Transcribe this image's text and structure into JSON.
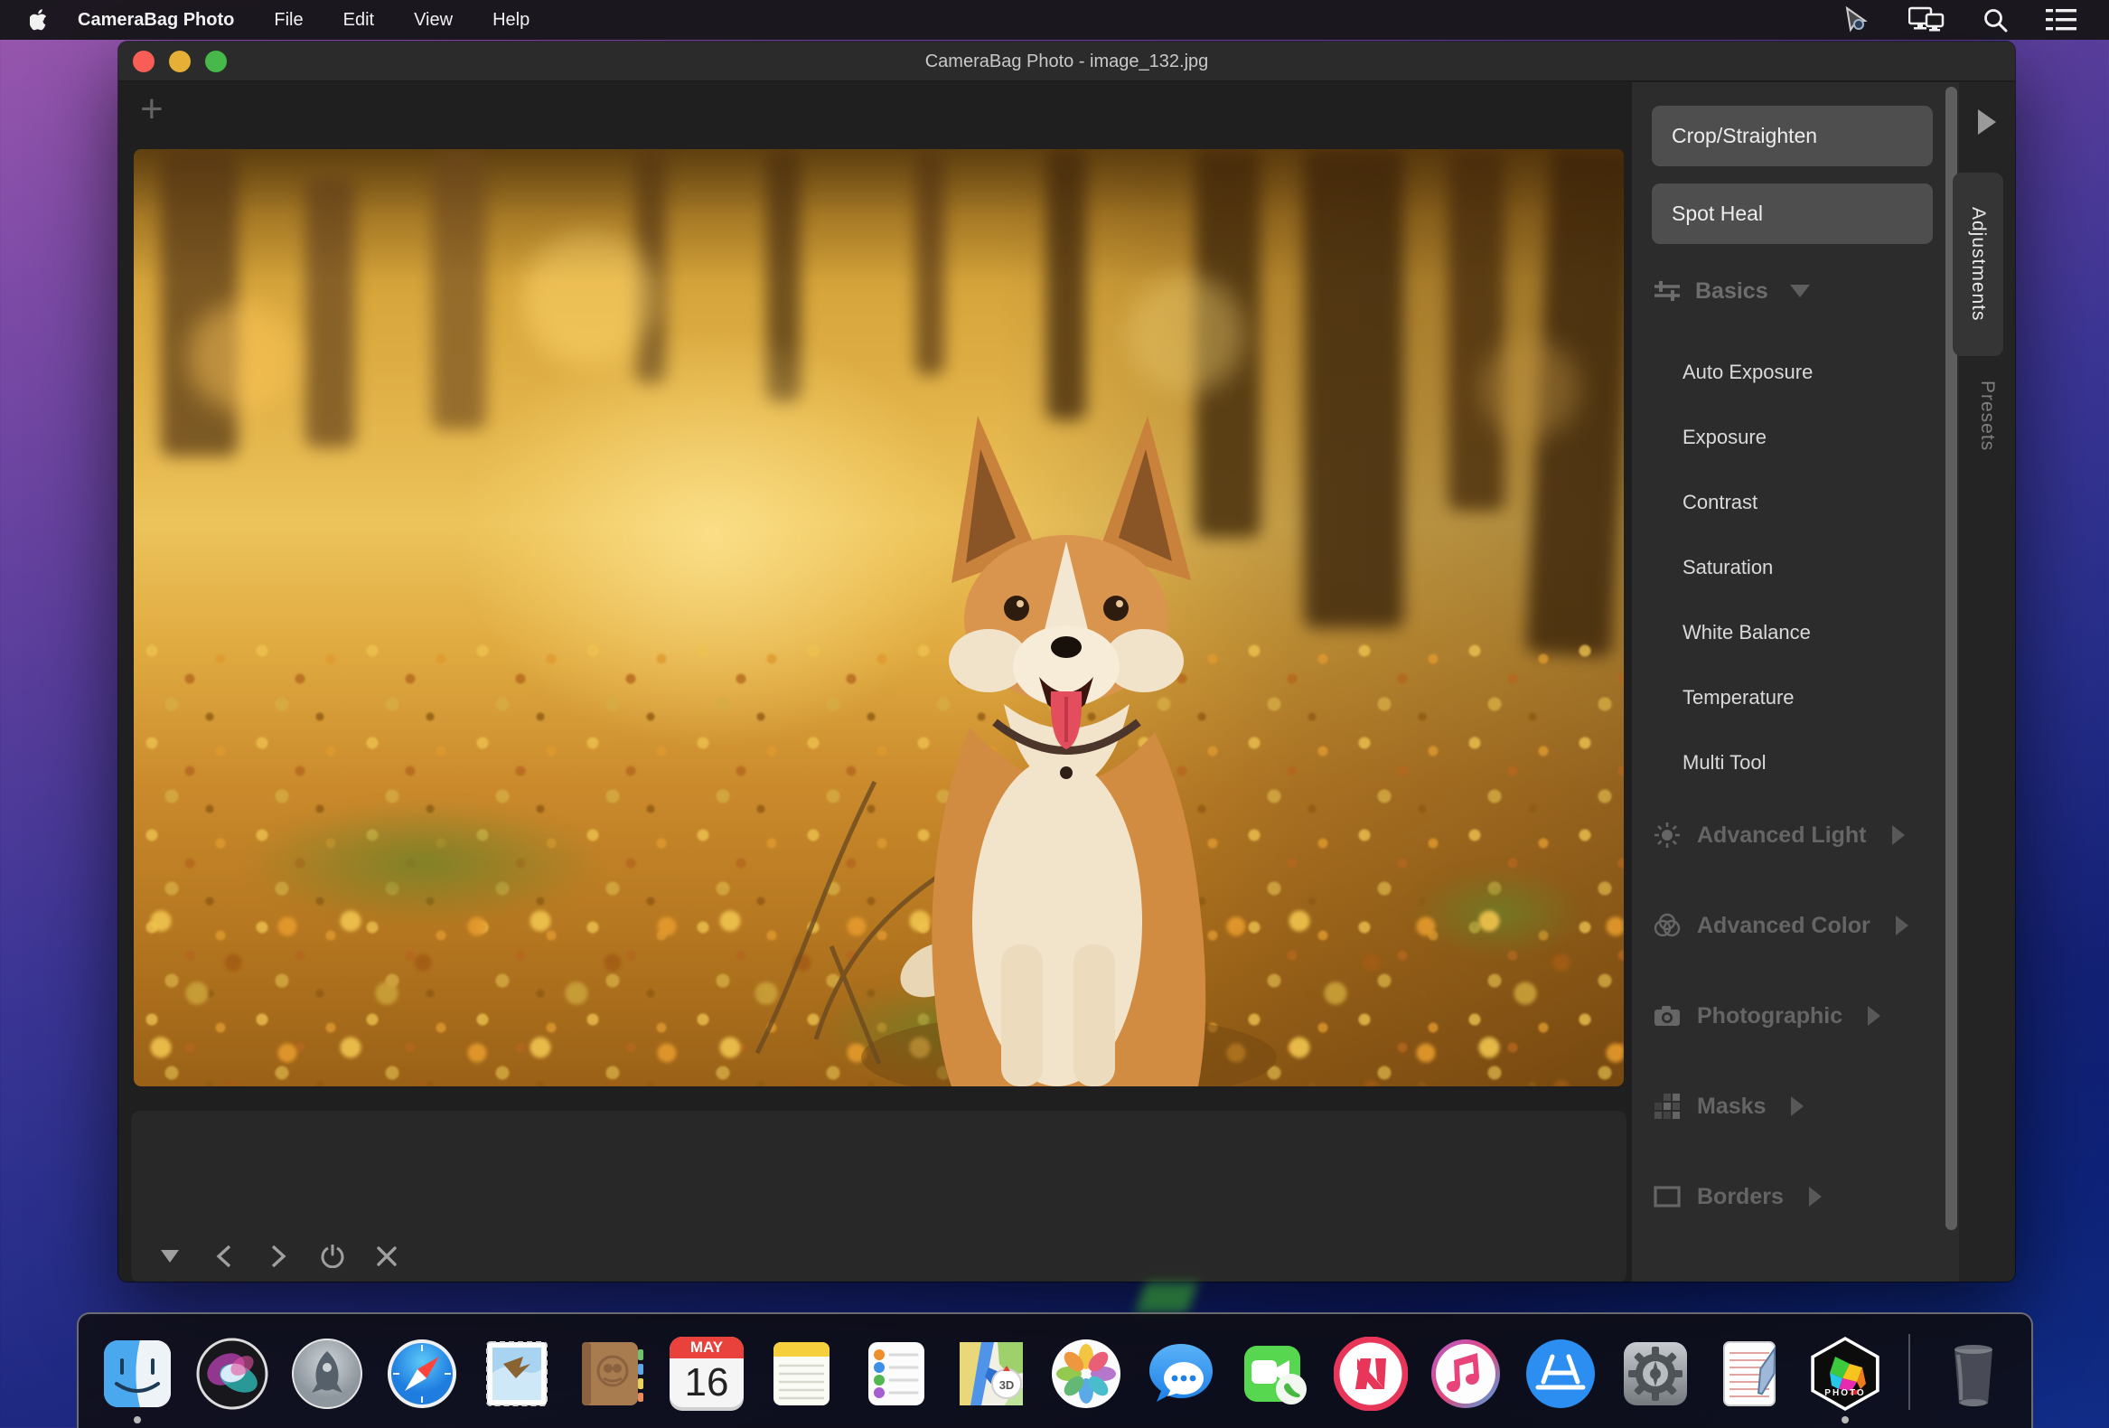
{
  "menu_bar": {
    "app_name": "CameraBag Photo",
    "items": [
      "File",
      "Edit",
      "View",
      "Help"
    ]
  },
  "window": {
    "title": "CameraBag Photo - image_132.jpg"
  },
  "canvas": {
    "add_label": "+"
  },
  "sidebar": {
    "buttons": {
      "crop": "Crop/Straighten",
      "spot_heal": "Spot Heal"
    },
    "basics": {
      "label": "Basics",
      "items": [
        "Auto Exposure",
        "Exposure",
        "Contrast",
        "Saturation",
        "White Balance",
        "Temperature",
        "Multi Tool"
      ]
    },
    "groups": [
      {
        "label": "Advanced Light"
      },
      {
        "label": "Advanced Color"
      },
      {
        "label": "Photographic"
      },
      {
        "label": "Masks"
      },
      {
        "label": "Borders"
      }
    ],
    "tabs": {
      "adjustments": "Adjustments",
      "presets": "Presets"
    }
  },
  "dock": {
    "items": [
      "Finder",
      "Siri",
      "Launchpad",
      "Safari",
      "Mail",
      "Contacts",
      "Calendar",
      "Notes",
      "Reminders",
      "Maps",
      "Photos",
      "Messages",
      "FaceTime",
      "News",
      "iTunes",
      "App Store",
      "System Preferences",
      "TextEdit",
      "CameraBag Photo",
      "Trash"
    ],
    "calendar": {
      "month": "MAY",
      "day": "16"
    },
    "maps_badge": "3D",
    "camerabag_label": "PHOTO"
  },
  "colors": {
    "desktop_purple": "#9a57ae",
    "desktop_blue": "#0a175e",
    "traffic_red": "#f95e56",
    "traffic_yellow": "#e6b036",
    "traffic_green": "#46b94a",
    "sidebar_bg": "#2c2c2c",
    "button_bg": "#4e4e4e"
  }
}
